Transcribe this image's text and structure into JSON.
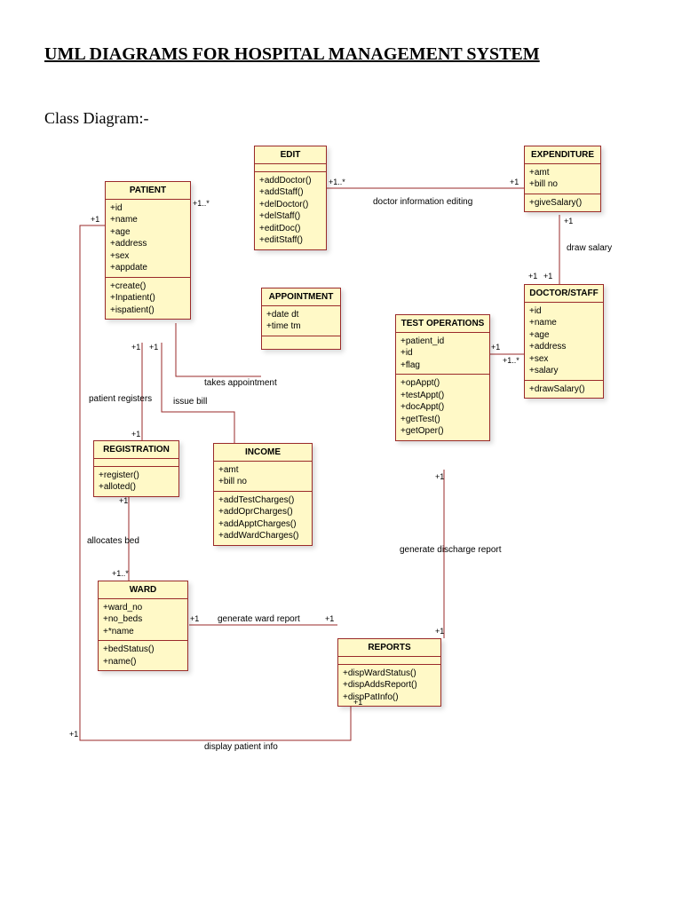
{
  "title": "UML DIAGRAMS FOR HOSPITAL MANAGEMENT SYSTEM",
  "subtitle": "Class Diagram:-",
  "classes": {
    "patient": {
      "name": "PATIENT",
      "attrs": [
        "+id",
        "+name",
        "+age",
        "+address",
        "+sex",
        "+appdate"
      ],
      "ops": [
        "+create()",
        "+Inpatient()",
        "+ispatient()"
      ]
    },
    "edit": {
      "name": "EDIT",
      "attrs": [],
      "ops": [
        "+addDoctor()",
        "+addStaff()",
        "+delDoctor()",
        "+delStaff()",
        "+editDoc()",
        "+editStaff()"
      ]
    },
    "expenditure": {
      "name": "EXPENDITURE",
      "attrs": [
        "+amt",
        "+bill no"
      ],
      "ops": [
        "+giveSalary()"
      ]
    },
    "appointment": {
      "name": "APPOINTMENT",
      "attrs": [
        "+date dt",
        "+time tm"
      ],
      "ops": []
    },
    "doctorstaff": {
      "name": "DOCTOR/STAFF",
      "attrs": [
        "+id",
        "+name",
        "+age",
        "+address",
        "+sex",
        "+salary"
      ],
      "ops": [
        "+drawSalary()"
      ]
    },
    "testops": {
      "name": "TEST OPERATIONS",
      "attrs": [
        "+patient_id",
        "+id",
        "+flag"
      ],
      "ops": [
        "+opAppt()",
        "+testAppt()",
        "+docAppt()",
        "+getTest()",
        "+getOper()"
      ]
    },
    "registration": {
      "name": "REGISTRATION",
      "attrs": [],
      "ops": [
        "+register()",
        "+alloted()"
      ]
    },
    "income": {
      "name": "INCOME",
      "attrs": [
        "+amt",
        "+bill no"
      ],
      "ops": [
        "+addTestCharges()",
        "+addOprCharges()",
        "+addApptCharges()",
        "+addWardCharges()"
      ]
    },
    "ward": {
      "name": "WARD",
      "attrs": [
        "+ward_no",
        "+no_beds",
        "+*name"
      ],
      "ops": [
        "+bedStatus()",
        "+name()"
      ]
    },
    "reports": {
      "name": "REPORTS",
      "attrs": [],
      "ops": [
        "+dispWardStatus()",
        "+dispAddsReport()",
        "+dispPatInfo()"
      ]
    }
  },
  "labels": {
    "doctor_info_editing": "doctor information editing",
    "draw_salary": "draw salary",
    "patient_registers": "patient registers",
    "issue_bill": "issue bill",
    "takes_appointment": "takes appointment",
    "allocates_bed": "allocates bed",
    "generate_ward_report": "generate ward report",
    "generate_discharge_report": "generate discharge report",
    "display_patient_info": "display patient info"
  },
  "mult": {
    "one": "+1",
    "one_many": "+1..*"
  }
}
